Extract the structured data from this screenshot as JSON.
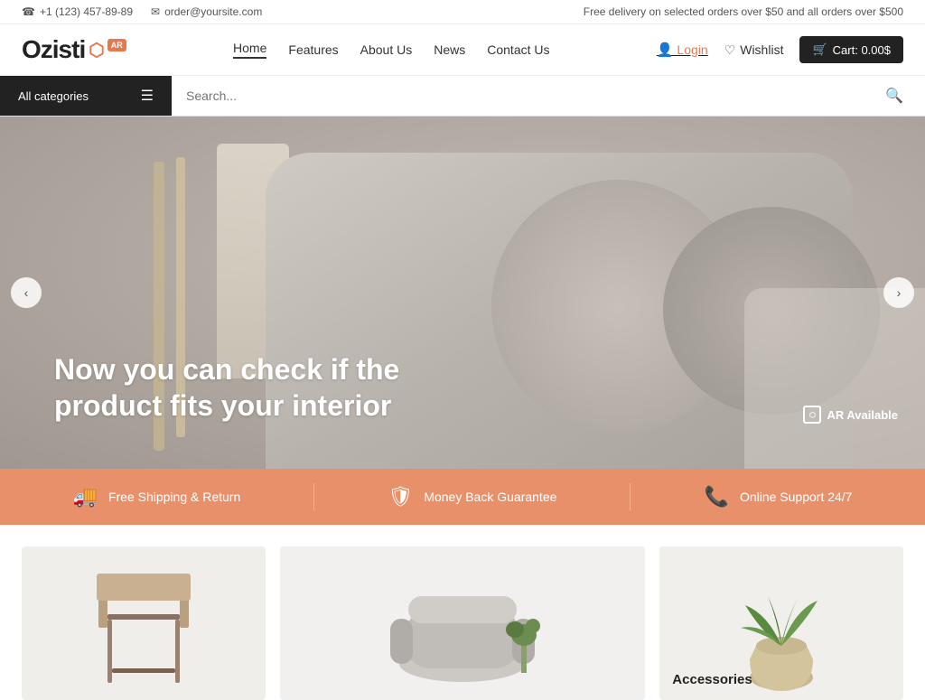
{
  "topbar": {
    "phone": "+1 (123) 457-89-89",
    "email": "order@yoursite.com",
    "delivery_notice": "Free delivery on selected orders over $50 and all orders over $500",
    "phone_icon": "☎",
    "email_icon": "✉"
  },
  "header": {
    "logo_text": "Ozisti",
    "logo_ar_badge": "AR",
    "nav": [
      {
        "label": "Home",
        "active": true
      },
      {
        "label": "Features",
        "active": false
      },
      {
        "label": "About Us",
        "active": false
      },
      {
        "label": "News",
        "active": false
      },
      {
        "label": "Contact Us",
        "active": false
      }
    ],
    "login_label": "Login",
    "wishlist_label": "Wishlist",
    "cart_label": "Cart: 0.00$"
  },
  "search": {
    "categories_label": "All categories",
    "placeholder": "Search..."
  },
  "hero": {
    "title": "Now you can check if the product fits your interior",
    "ar_badge": "AR Available",
    "prev_arrow": "‹",
    "next_arrow": "›"
  },
  "benefits": [
    {
      "icon": "🚚",
      "label": "Free Shipping & Return"
    },
    {
      "icon": "🛡",
      "label": "Money Back Guarantee"
    },
    {
      "icon": "📞",
      "label": "Online Support 24/7"
    }
  ],
  "products": [
    {
      "label": ""
    },
    {
      "label": ""
    },
    {
      "label": "Accessories"
    }
  ]
}
